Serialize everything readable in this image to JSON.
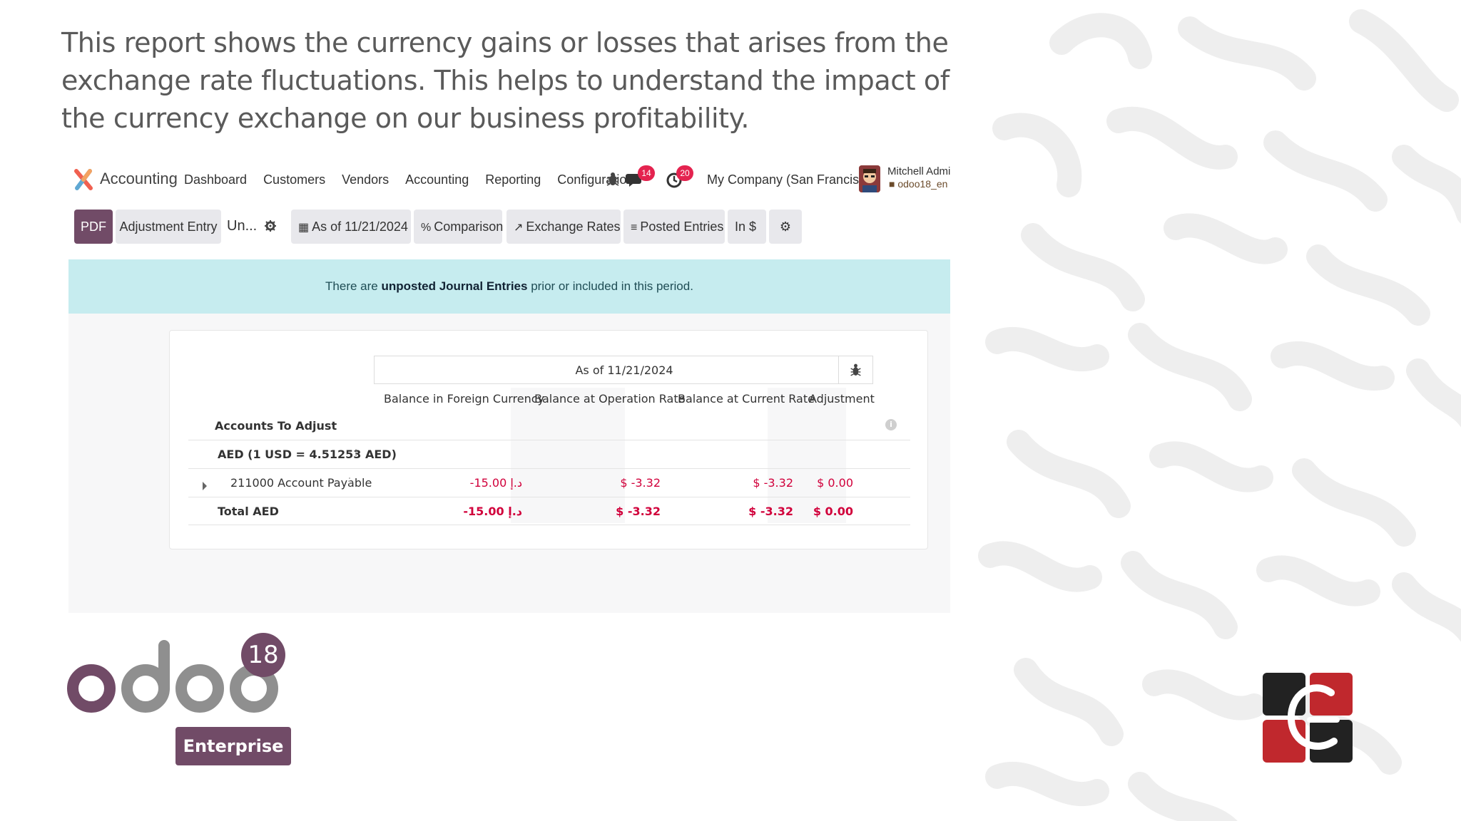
{
  "headline": "This report shows the currency gains or losses that arises from the exchange rate fluctuations. This helps to understand the impact of the currency exchange on our business profitability.",
  "navbar": {
    "app_title": "Accounting",
    "menu": [
      "Dashboard",
      "Customers",
      "Vendors",
      "Accounting",
      "Reporting",
      "Configuration"
    ],
    "chat_badge": "14",
    "activity_badge": "20",
    "company": "My Company (San Francisco)",
    "user_name": "Mitchell Admin",
    "user_db": "odoo18_en"
  },
  "toolbar": {
    "pdf": "PDF",
    "adjustment_entry": "Adjustment Entry",
    "report_name": "Un...",
    "as_of": "As of 11/21/2024",
    "comparison": "Comparison",
    "exchange_rates": "Exchange Rates",
    "posted_entries": "Posted Entries",
    "in_currency": "In $"
  },
  "alert": {
    "prefix": "There are ",
    "link": "unposted Journal Entries",
    "suffix": " prior or included in this period."
  },
  "report": {
    "period": "As of 11/21/2024",
    "columns": [
      "Balance in Foreign Currency",
      "Balance at Operation Rate",
      "Balance at Current Rate",
      "Adjustment"
    ],
    "section_title": "Accounts To Adjust",
    "group": "AED (1 USD = 4.51253 AED)",
    "rows": [
      {
        "label": "211000 Account Payable",
        "values": [
          "-15.00 د.إ",
          "$ -3.32",
          "$ -3.32",
          "$ 0.00"
        ]
      }
    ],
    "total": {
      "label": "Total AED",
      "values": [
        "-15.00 د.إ",
        "$ -3.32",
        "$ -3.32",
        "$ 0.00"
      ]
    }
  },
  "brand": {
    "version": "18",
    "edition": "Enterprise"
  },
  "colors": {
    "primary": "#714b67",
    "alert_bg": "#c6ecef",
    "negative": "#d1003b",
    "badge": "#e4234f"
  }
}
